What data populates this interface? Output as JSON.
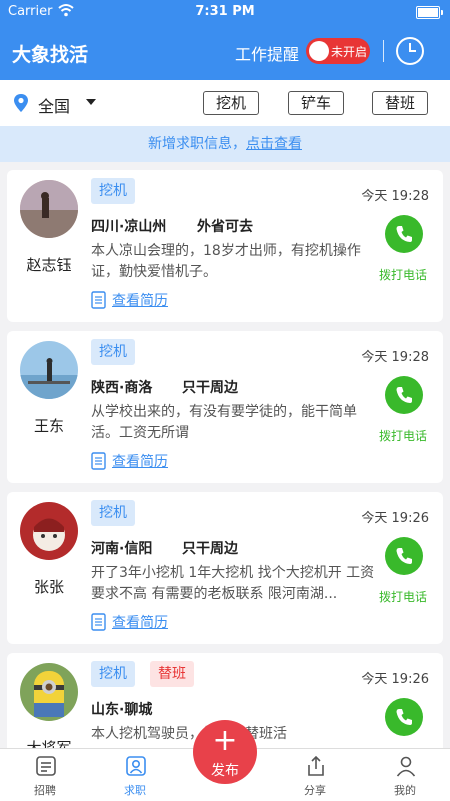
{
  "status": {
    "carrier": "Carrier",
    "time": "7:31 PM"
  },
  "header": {
    "title": "大象找活",
    "remind_label": "工作提醒",
    "toggle_text": "未开启"
  },
  "filter": {
    "location": "全国",
    "buttons": [
      "挖机",
      "铲车",
      "替班"
    ]
  },
  "banner": {
    "text": "新增求职信息，",
    "link": "点击查看"
  },
  "card_labels": {
    "resume": "查看简历",
    "call": "拨打电话"
  },
  "cards": [
    {
      "name": "赵志钰",
      "tags": [
        "挖机"
      ],
      "time": "今天 19:28",
      "location": "四川·凉山州",
      "availability": "外省可去",
      "desc": "本人凉山会理的，18岁才出师，有挖机操作证，勤快爱惜机子。"
    },
    {
      "name": "王东",
      "tags": [
        "挖机"
      ],
      "time": "今天 19:28",
      "location": "陕西·商洛",
      "availability": "只干周边",
      "desc": "从学校出来的，有没有要学徒的，能干简单活。工资无所谓"
    },
    {
      "name": "张张",
      "tags": [
        "挖机"
      ],
      "time": "今天 19:26",
      "location": "河南·信阳",
      "availability": "只干周边",
      "desc": "开了3年小挖机 1年大挖机 找个大挖机开 工资要求不高 有需要的老板联系 限河南湖..."
    },
    {
      "name": "大将军",
      "tags": [
        "挖机",
        "替班"
      ],
      "time": "今天 19:26",
      "location": "山东·聊城",
      "availability": "",
      "desc": "本人挖机驾驶员，找聊城替班活"
    }
  ],
  "tabbar": {
    "tabs": [
      "招聘",
      "求职",
      "分享",
      "我的"
    ],
    "publish": "发布"
  },
  "colors": {
    "primary": "#3b8ef0",
    "call_green": "#39b92b",
    "publish_red": "#e8414a",
    "toggle_red": "#e83535"
  }
}
